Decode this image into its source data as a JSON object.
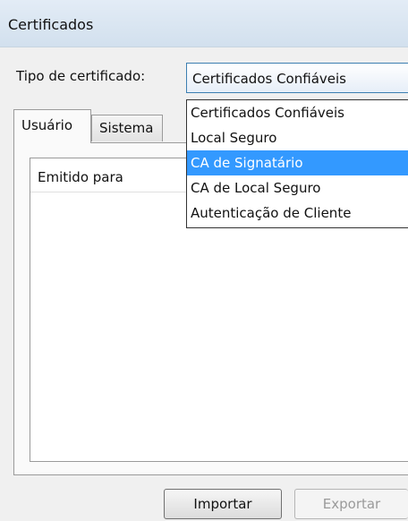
{
  "window": {
    "title": "Certificados"
  },
  "certificate_type": {
    "label": "Tipo de certificado:",
    "selected": "Certificados Confiáveis",
    "options": [
      "Certificados Confiáveis",
      "Local Seguro",
      "CA de Signatário",
      "CA de Local Seguro",
      "Autenticação de Cliente"
    ],
    "highlighted_index": 2
  },
  "tabs": [
    {
      "label": "Usuário",
      "active": true
    },
    {
      "label": "Sistema",
      "active": false
    }
  ],
  "list": {
    "column_header": "Emitido para"
  },
  "buttons": {
    "import": "Importar",
    "export": "Exportar"
  },
  "colors": {
    "highlight": "#3399ff",
    "titlebar": "#dbe6f2"
  }
}
